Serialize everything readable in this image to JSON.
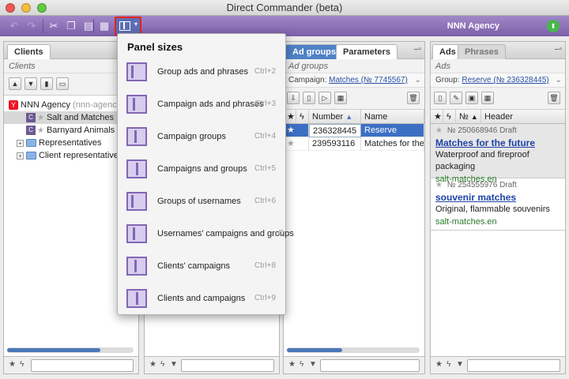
{
  "window": {
    "title": "Direct Commander (beta)"
  },
  "toolbar": {
    "agency": "NNN Agency"
  },
  "clients_pane": {
    "tabs": [
      "Clients"
    ],
    "subheader": "Clients",
    "tree": [
      {
        "label": "NNN Agency",
        "extra": "(nnn-agency-ex"
      },
      {
        "label": "Salt and Matches",
        "extra": ""
      },
      {
        "label": "Barnyard Animals",
        "extra": "(b"
      },
      {
        "label": "Representatives",
        "extra": ""
      },
      {
        "label": "Client representatives",
        "extra": ""
      }
    ]
  },
  "adgroups_pane": {
    "tabs": [
      "Ad groups",
      "Parameters"
    ],
    "subheader": "Ad groups",
    "campaign_prefix": "Campaign:",
    "campaign_link": "Matches (№ 7745567)",
    "columns": [
      "Number",
      "Name"
    ],
    "rows": [
      {
        "number": "236328445",
        "name": "Reserve"
      },
      {
        "number": "239593116",
        "name": "Matches for the fu"
      }
    ]
  },
  "ads_pane": {
    "tabs": [
      "Ads",
      "Phrases"
    ],
    "subheader": "Ads",
    "group_prefix": "Group:",
    "group_link": "Reserve (№ 236328445)",
    "columns": [
      "№",
      "Header"
    ],
    "ads": [
      {
        "meta": "№ 250668946  Draft",
        "title": "Matches for the future",
        "text": "Waterproof and fireproof packaging",
        "url": "salt-matches.en"
      },
      {
        "meta": "№ 254555976  Draft",
        "title": "souvenir matches",
        "text": "Original, flammable souvenirs",
        "url": "salt-matches.en"
      }
    ]
  },
  "panel_menu": {
    "title": "Panel sizes",
    "items": [
      {
        "label": "Group ads and phrases",
        "shortcut": "Ctrl+2"
      },
      {
        "label": "Campaign ads and phrases",
        "shortcut": "Ctrl+3"
      },
      {
        "label": "Campaign groups",
        "shortcut": "Ctrl+4"
      },
      {
        "label": "Campaigns and groups",
        "shortcut": "Ctrl+5"
      },
      {
        "label": "Groups of usernames",
        "shortcut": "Ctrl+6"
      },
      {
        "label": "Usernames' campaigns and groups",
        "shortcut": "C"
      },
      {
        "label": "Clients' campaigns",
        "shortcut": "Ctrl+8"
      },
      {
        "label": "Clients and campaigns",
        "shortcut": "Ctrl+9"
      }
    ]
  },
  "colors": {
    "toolbar": "#8a6fb8",
    "accent": "#4f81c7",
    "highlight": "#e3221f"
  }
}
